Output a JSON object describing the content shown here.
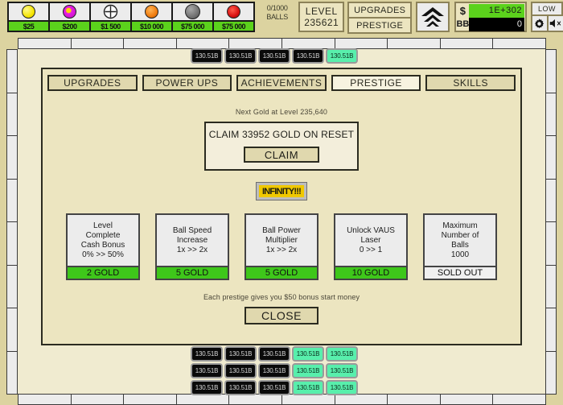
{
  "hud": {
    "ball_shop": [
      {
        "icon": "ball-yellow-icon",
        "color": "#f5e400",
        "price": "$25"
      },
      {
        "icon": "ball-magenta-icon",
        "color": "#e61ee6",
        "price": "$200"
      },
      {
        "icon": "ball-plus-icon",
        "color": "#ffffff",
        "price": "$1 500"
      },
      {
        "icon": "ball-orange-icon",
        "color": "#f07d10",
        "price": "$10 000"
      },
      {
        "icon": "ball-gray-icon",
        "color": "#707070",
        "price": "$75 000"
      },
      {
        "icon": "ball-red-icon",
        "color": "#e01010",
        "price": "$75 000"
      }
    ],
    "balls_counter_line1": "0/1000",
    "balls_counter_line2": "BALLS",
    "level_label": "LEVEL",
    "level_value": "235621",
    "upgrades_button": "UPGRADES",
    "prestige_button": "PRESTIGE",
    "boost_icon": "double-chevron-up-icon",
    "money": {
      "cash_symbol": "$",
      "cash_value": "1E+302",
      "bb_symbol": "BB",
      "bb_value": "0"
    },
    "quality_button": "LOW",
    "settings_icon": "gear-icon",
    "sound_icon": "speaker-muted-icon"
  },
  "playfield": {
    "brick_label": "130.51B",
    "top_row": [
      "black",
      "black",
      "black",
      "black",
      "green"
    ],
    "bottom_grid": [
      [
        "black",
        "black",
        "black",
        "green",
        "green"
      ],
      [
        "black",
        "black",
        "black",
        "green",
        "green"
      ],
      [
        "black",
        "black",
        "black",
        "green",
        "green"
      ]
    ]
  },
  "panel": {
    "tabs": [
      {
        "label": "UPGRADES",
        "active": false
      },
      {
        "label": "POWER UPS",
        "active": false
      },
      {
        "label": "ACHIEVEMENTS",
        "active": false
      },
      {
        "label": "PRESTIGE",
        "active": true
      },
      {
        "label": "SKILLS",
        "active": false
      }
    ],
    "next_gold": "Next Gold at Level 235,640",
    "claim_text": "CLAIM 33952 GOLD ON RESET",
    "claim_button": "CLAIM",
    "infinity_button": "INFINITY!!!",
    "cards": [
      {
        "title_line1": "Level",
        "title_line2": "Complete",
        "title_line3": "Cash Bonus",
        "progress": "0% >> 50%",
        "cost": "2 GOLD",
        "sold_out": false
      },
      {
        "title_line1": "Ball Speed",
        "title_line2": "Increase",
        "title_line3": "",
        "progress": "1x >> 2x",
        "cost": "5 GOLD",
        "sold_out": false
      },
      {
        "title_line1": "Ball Power",
        "title_line2": "Multiplier",
        "title_line3": "",
        "progress": "1x >> 2x",
        "cost": "5 GOLD",
        "sold_out": false
      },
      {
        "title_line1": "Unlock VAUS",
        "title_line2": "Laser",
        "title_line3": "",
        "progress": "0 >> 1",
        "cost": "10 GOLD",
        "sold_out": false
      },
      {
        "title_line1": "Maximum",
        "title_line2": "Number of",
        "title_line3": "Balls",
        "progress": "1000",
        "cost": "SOLD OUT",
        "sold_out": true
      }
    ],
    "footnote": "Each prestige gives you $50 bonus start money",
    "close_button": "CLOSE"
  }
}
